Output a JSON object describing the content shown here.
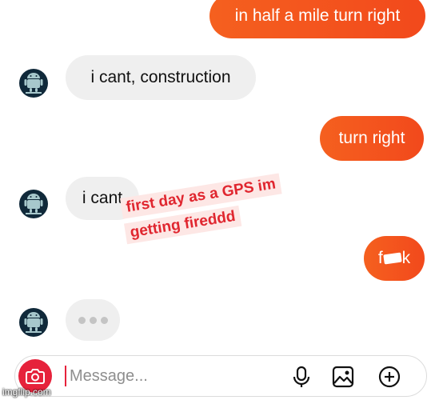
{
  "messages": [
    {
      "side": "out",
      "text": "in half a mile turn right"
    },
    {
      "side": "in",
      "text": "i cant, construction"
    },
    {
      "side": "out",
      "text": "turn right"
    },
    {
      "side": "in",
      "text": "i cant"
    },
    {
      "side": "out",
      "text_start": "f",
      "text_end": "k",
      "censored": true
    },
    {
      "side": "in",
      "typing": true
    }
  ],
  "sticker": {
    "line1": "first day as a GPS im",
    "line2": "getting fireddd"
  },
  "composer": {
    "placeholder": "Message...",
    "icons": [
      "camera-icon",
      "microphone-icon",
      "image-icon",
      "plus-circle-icon"
    ]
  },
  "watermark": "imgflip.com",
  "colors": {
    "outgoing_bubble": "#f3541e",
    "incoming_bubble": "#efefef",
    "camera_button": "#e6223b",
    "sticker_text": "#e0262f",
    "sticker_bg": "#fde7e5"
  }
}
